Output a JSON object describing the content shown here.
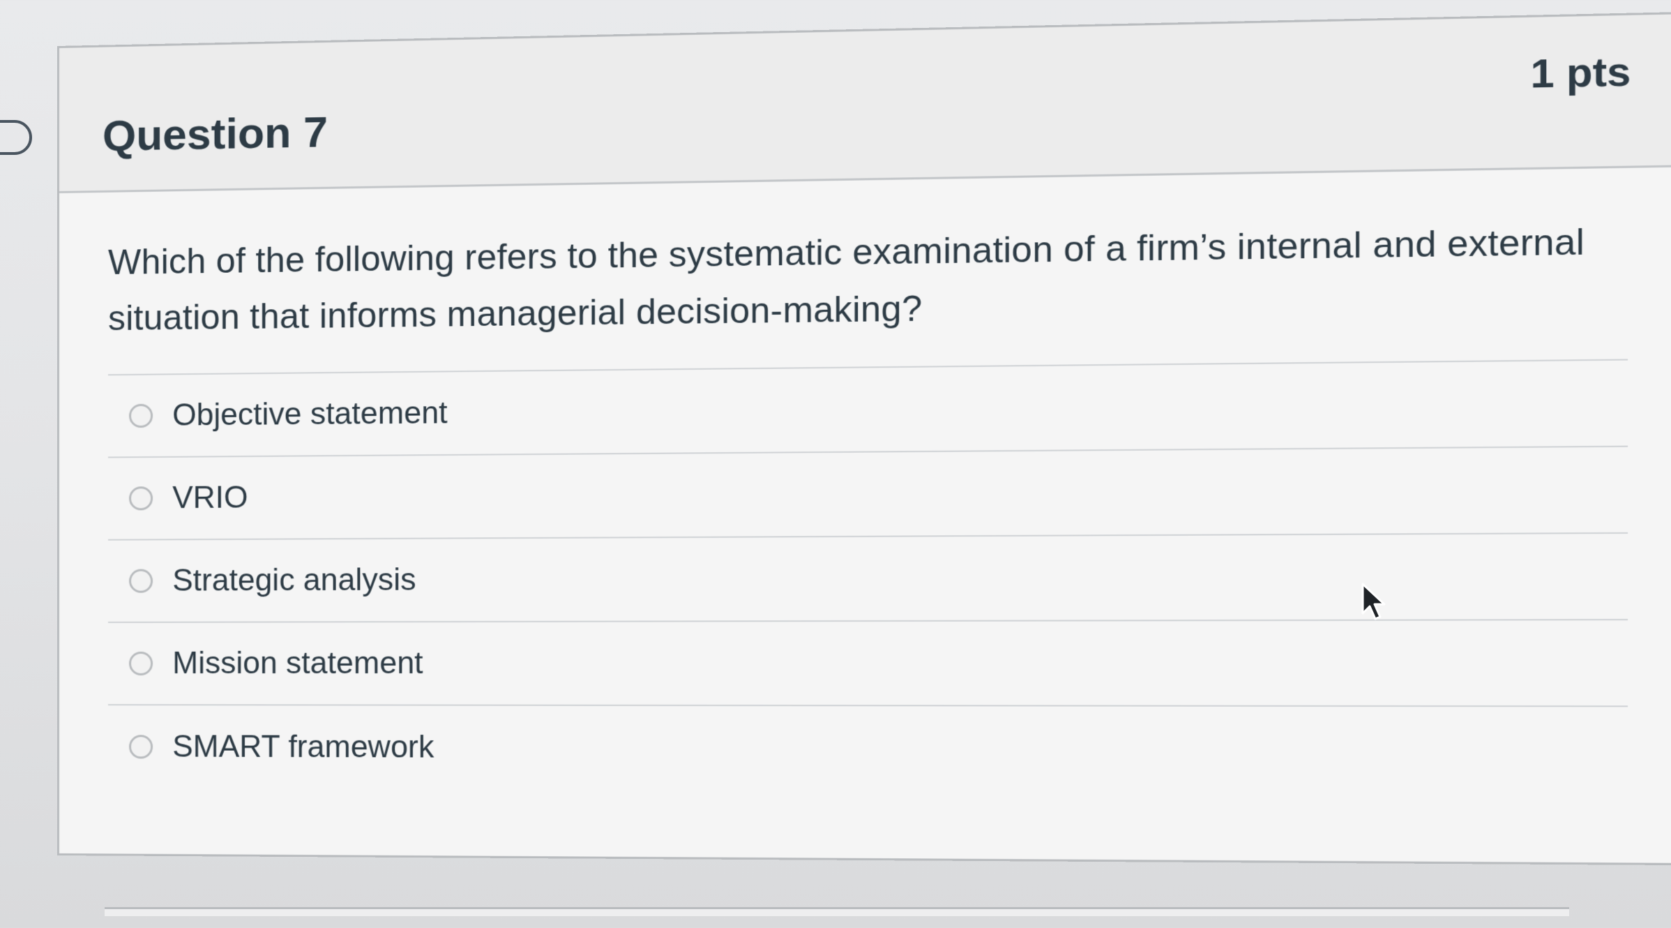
{
  "question": {
    "title": "Question 7",
    "points": "1 pts",
    "text": "Which of the following refers to the systematic examination of a firm’s internal and external situation that informs managerial decision-making?"
  },
  "answers": [
    {
      "label": "Objective statement",
      "selected": false
    },
    {
      "label": "VRIO",
      "selected": false
    },
    {
      "label": "Strategic analysis",
      "selected": false
    },
    {
      "label": "Mission statement",
      "selected": false
    },
    {
      "label": "SMART framework",
      "selected": false
    }
  ],
  "icons": {
    "flag": "flag-icon",
    "radio": "radio-icon",
    "cursor": "mouse-pointer-icon"
  },
  "colors": {
    "text": "#2d3b45",
    "border": "#b9bcbf",
    "card_background": "#f5f5f5",
    "header_background": "#ececec"
  }
}
